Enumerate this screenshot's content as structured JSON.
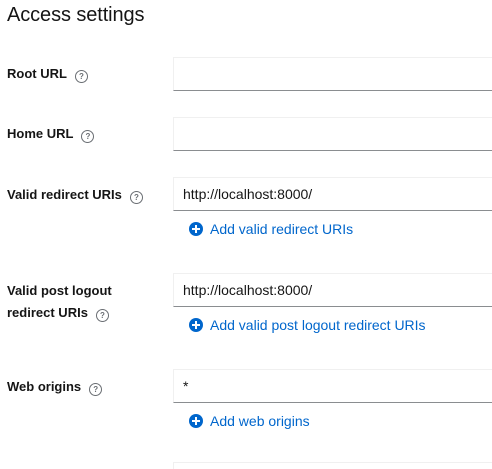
{
  "section": {
    "title": "Access settings"
  },
  "fields": {
    "root_url": {
      "label": "Root URL",
      "value": ""
    },
    "home_url": {
      "label": "Home URL",
      "value": ""
    },
    "valid_redirect_uris": {
      "label": "Valid redirect URIs",
      "value": "http://localhost:8000/",
      "add_label": "Add valid redirect URIs"
    },
    "valid_post_logout": {
      "label_line1": "Valid post logout",
      "label_line2": "redirect URIs",
      "value": "http://localhost:8000/",
      "add_label": "Add valid post logout redirect URIs"
    },
    "web_origins": {
      "label": "Web origins",
      "value": "*",
      "add_label": "Add web origins"
    }
  },
  "icons": {
    "help": "?",
    "add": "plus-circle-icon"
  },
  "colors": {
    "link": "#0066cc",
    "text": "#151515",
    "icon_gray": "#6a6e73",
    "input_border": "#8a8d90"
  }
}
